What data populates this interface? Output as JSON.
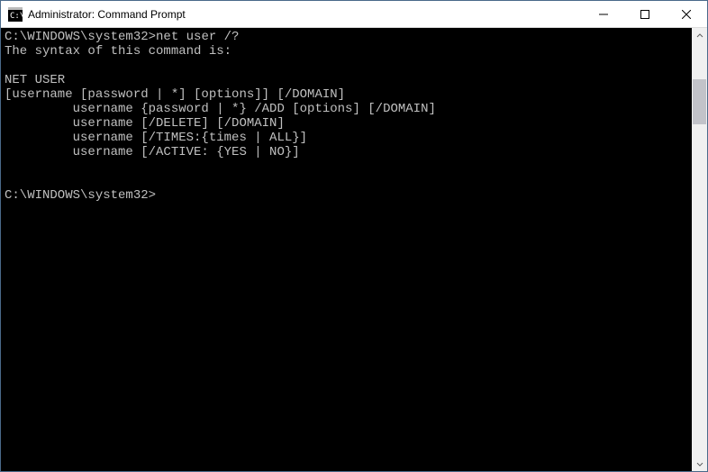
{
  "window": {
    "title": "Administrator: Command Prompt"
  },
  "terminal": {
    "prompt1": "C:\\WINDOWS\\system32>",
    "command1": "net user /?",
    "out1": "The syntax of this command is:",
    "out2": "",
    "out3": "NET USER",
    "out4": "[username [password | *] [options]] [/DOMAIN]",
    "out5": "         username {password | *} /ADD [options] [/DOMAIN]",
    "out6": "         username [/DELETE] [/DOMAIN]",
    "out7": "         username [/TIMES:{times | ALL}]",
    "out8": "         username [/ACTIVE: {YES | NO}]",
    "out9": "",
    "out10": "",
    "prompt2": "C:\\WINDOWS\\system32>"
  }
}
